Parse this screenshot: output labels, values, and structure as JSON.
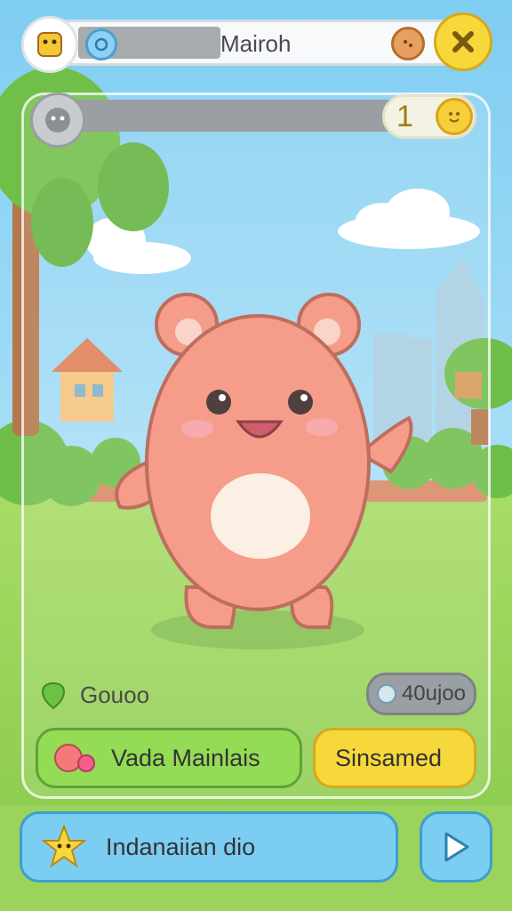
{
  "header": {
    "player_name": "Mairoh",
    "close_icon": "close-icon"
  },
  "stats": {
    "count": "1"
  },
  "info": {
    "label": "Gouoo",
    "currency_value": "40ujoo"
  },
  "actions": {
    "primary_label": "Vada Mainlais",
    "secondary_label": "Sinsamed",
    "bottom_label": "Indanaiian dio",
    "play_icon": "play-icon"
  },
  "colors": {
    "sky": "#8fd4f4",
    "grass": "#9ed65a",
    "creature": "#f4907a",
    "accent_yellow": "#f7d83a",
    "green_button": "#94db56",
    "blue_button": "#7ccdf2"
  }
}
